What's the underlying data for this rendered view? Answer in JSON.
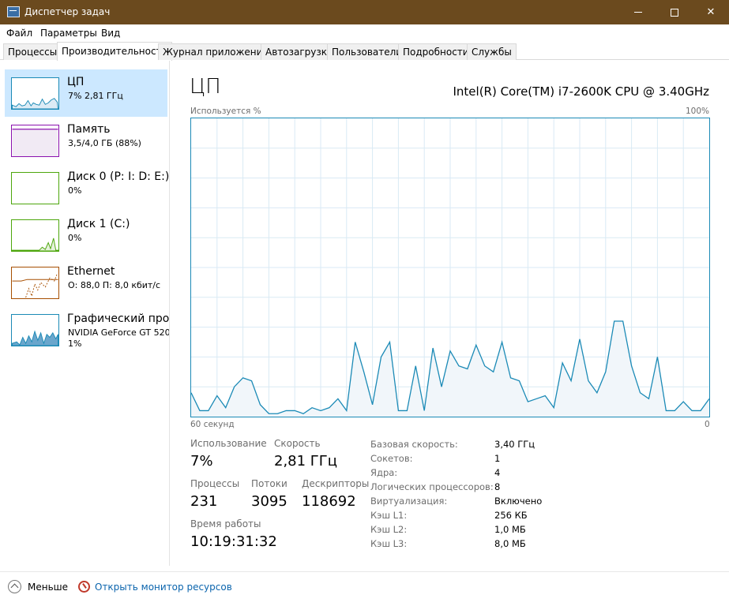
{
  "window": {
    "title": "Диспетчер задач"
  },
  "menu": [
    "Файл",
    "Параметры",
    "Вид"
  ],
  "tabs": [
    "Процессы",
    "Производительность",
    "Журнал приложений",
    "Автозагрузка",
    "Пользователи",
    "Подробности",
    "Службы"
  ],
  "active_tab": "Производительность",
  "sidebar": [
    {
      "name": "ЦП",
      "sub": "7% 2,81 ГГц",
      "color": "#1b8ab6"
    },
    {
      "name": "Память",
      "sub": "3,5/4,0 ГБ (88%)",
      "color": "#8b12ae"
    },
    {
      "name": "Диск 0 (P: I: D: E:)",
      "sub": "0%",
      "color": "#4da60c"
    },
    {
      "name": "Диск 1 (C:)",
      "sub": "0%",
      "color": "#4da60c"
    },
    {
      "name": "Ethernet",
      "sub": "О: 88,0 П: 8,0 кбит/с",
      "color": "#a74f01"
    },
    {
      "name": "Графический проц",
      "sub": "NVIDIA GeForce GT 520",
      "sub2": "1%",
      "color": "#1b8ab6"
    }
  ],
  "main": {
    "title": "ЦП",
    "cpu_model": "Intel(R) Core(TM) i7-2600K CPU @ 3.40GHz",
    "y_label": "Используется %",
    "y_max_label": "100%",
    "x_label": "60 секунд",
    "x_min_label": "0"
  },
  "chart_data": {
    "type": "area",
    "title": "",
    "xlabel": "60 секунд",
    "ylabel": "Используется %",
    "xlim": [
      60,
      0
    ],
    "ylim": [
      0,
      100
    ],
    "grid": true,
    "x": [
      60,
      59,
      58,
      57,
      56,
      55,
      54,
      53,
      52,
      51,
      50,
      49,
      48,
      47,
      46,
      45,
      44,
      43,
      42,
      41,
      40,
      39,
      38,
      37,
      36,
      35,
      34,
      33,
      32,
      31,
      30,
      29,
      28,
      27,
      26,
      25,
      24,
      23,
      22,
      21,
      20,
      19,
      18,
      17,
      16,
      15,
      14,
      13,
      12,
      11,
      10,
      9,
      8,
      7,
      6,
      5,
      4,
      3,
      2,
      1,
      0
    ],
    "series": [
      {
        "color": "#1b8ab6",
        "values": [
          8,
          2,
          2,
          7,
          3,
          10,
          13,
          12,
          4,
          1,
          1,
          2,
          2,
          1,
          3,
          2,
          3,
          6,
          2,
          25,
          15,
          4,
          20,
          25,
          2,
          2,
          17,
          2,
          23,
          10,
          22,
          17,
          16,
          24,
          17,
          15,
          25,
          13,
          12,
          5,
          6,
          7,
          3,
          18,
          12,
          26,
          12,
          8,
          15,
          32,
          32,
          17,
          8,
          6,
          20,
          2,
          2,
          5,
          2,
          2,
          6
        ]
      }
    ]
  },
  "stats": {
    "usage": {
      "label": "Использование",
      "value": "7%"
    },
    "speed": {
      "label": "Скорость",
      "value": "2,81 ГГц"
    },
    "processes": {
      "label": "Процессы",
      "value": "231"
    },
    "threads": {
      "label": "Потоки",
      "value": "3095"
    },
    "handles": {
      "label": "Дескрипторы",
      "value": "118692"
    },
    "uptime": {
      "label": "Время работы",
      "value": "10:19:31:32"
    }
  },
  "info": [
    {
      "label": "Базовая скорость:",
      "value": "3,40 ГГц"
    },
    {
      "label": "Сокетов:",
      "value": "1"
    },
    {
      "label": "Ядра:",
      "value": "4"
    },
    {
      "label": "Логических процессоров:",
      "value": "8"
    },
    {
      "label": "Виртуализация:",
      "value": "Включено"
    },
    {
      "label": "Кэш L1:",
      "value": "256 КБ"
    },
    {
      "label": "Кэш L2:",
      "value": "1,0 МБ"
    },
    {
      "label": "Кэш L3:",
      "value": "8,0 МБ"
    }
  ],
  "footer": {
    "fewer": "Меньше",
    "resmon": "Открыть монитор ресурсов"
  }
}
